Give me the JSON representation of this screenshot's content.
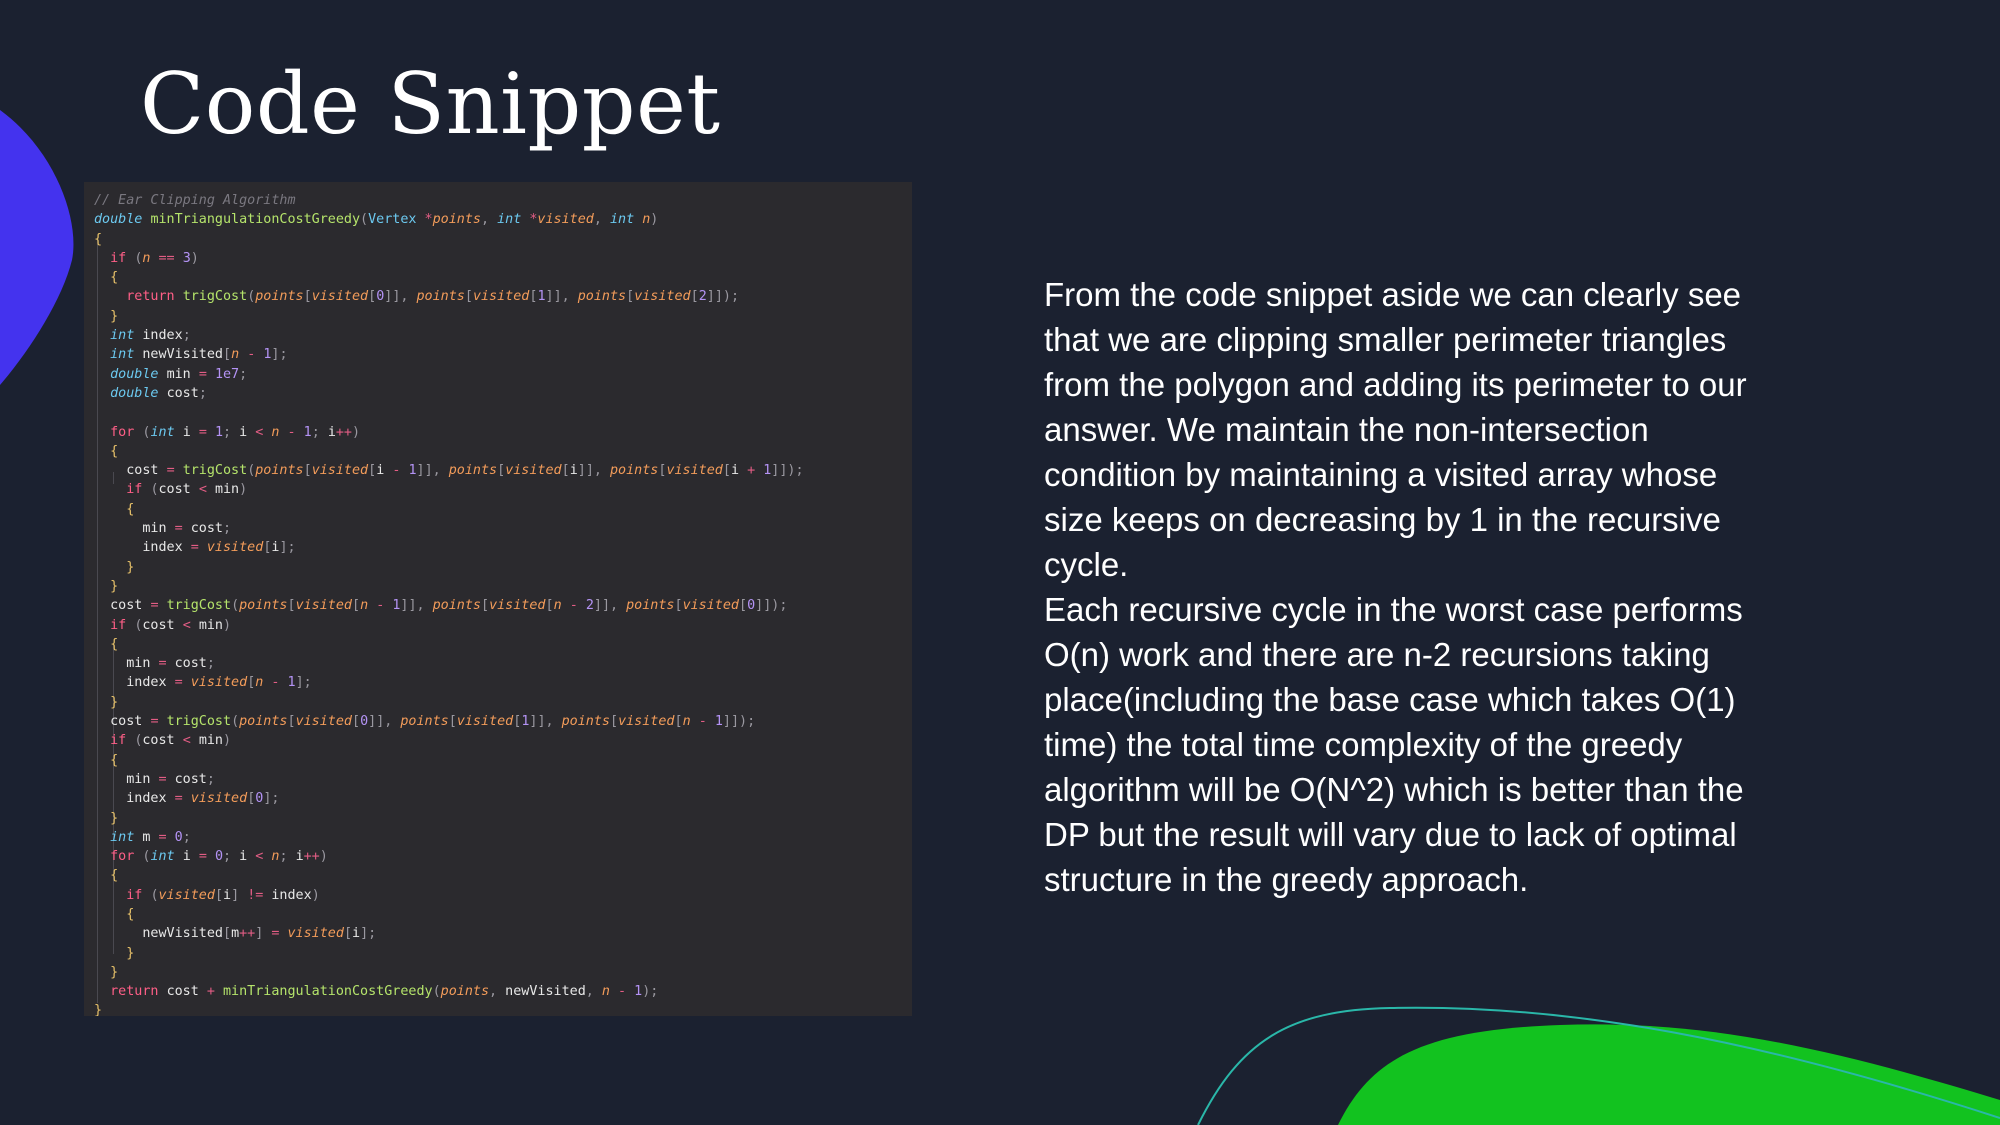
{
  "slide": {
    "title": "Code Snippet",
    "paragraphs": [
      "From the code snippet aside we can clearly see that we are clipping smaller perimeter triangles from the polygon and adding its perimeter to our answer. We maintain the non-intersection condition by maintaining a visited array whose size keeps on decreasing by 1 in the recursive cycle.",
      "Each recursive cycle in the worst case performs O(n) work and there are n-2 recursions taking place(including the base case which takes O(1) time) the total time complexity of the greedy algorithm will be O(N^2) which is better than the DP but the result will vary due to lack of optimal structure in the greedy approach."
    ]
  },
  "colors": {
    "background": "#1b2130",
    "code_background": "#2b2a2e",
    "accent_blue": "#4433ee",
    "accent_green": "#12c21f",
    "accent_teal_line": "#2ab7a9"
  },
  "code": {
    "lines": [
      "// Ear Clipping Algorithm",
      "double minTriangulationCostGreedy(Vertex *points, int *visited, int n)",
      "{",
      "  if (n == 3)",
      "  {",
      "    return trigCost(points[visited[0]], points[visited[1]], points[visited[2]]);",
      "  }",
      "  int index;",
      "  int newVisited[n - 1];",
      "  double min = 1e7;",
      "  double cost;",
      "",
      "  for (int i = 1; i < n - 1; i++)",
      "  {",
      "    cost = trigCost(points[visited[i - 1]], points[visited[i]], points[visited[i + 1]]);",
      "    if (cost < min)",
      "    {",
      "      min = cost;",
      "      index = visited[i];",
      "    }",
      "  }",
      "  cost = trigCost(points[visited[n - 1]], points[visited[n - 2]], points[visited[0]]);",
      "  if (cost < min)",
      "  {",
      "    min = cost;",
      "    index = visited[n - 1];",
      "  }",
      "  cost = trigCost(points[visited[0]], points[visited[1]], points[visited[n - 1]]);",
      "  if (cost < min)",
      "  {",
      "    min = cost;",
      "    index = visited[0];",
      "  }",
      "  int m = 0;",
      "  for (int i = 0; i < n; i++)",
      "  {",
      "    if (visited[i] != index)",
      "    {",
      "      newVisited[m++] = visited[i];",
      "    }",
      "  }",
      "  return cost + minTriangulationCostGreedy(points, newVisited, n - 1);",
      "}"
    ]
  }
}
